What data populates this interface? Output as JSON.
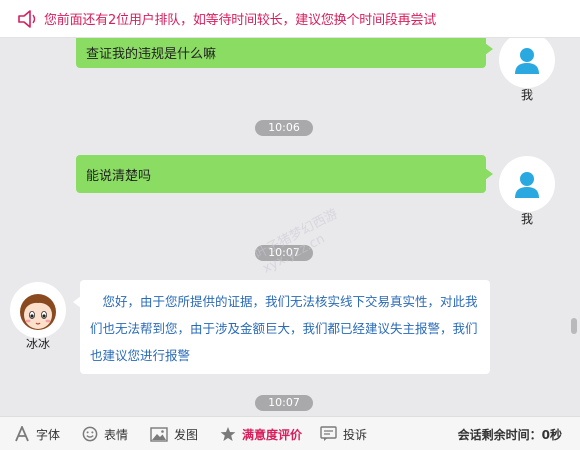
{
  "notice": {
    "text": "您前面还有2位用户排队，如等待时间较长，建议您换个时间段再尝试",
    "icon": "speaker-icon",
    "color": "#d81e5b"
  },
  "messages": [
    {
      "sender": "me",
      "name": "我",
      "text": "查证我的违规是什么嘛"
    },
    {
      "type": "time",
      "text": "10:06"
    },
    {
      "sender": "me",
      "name": "我",
      "text": "能说清楚吗"
    },
    {
      "type": "time",
      "text": "10:07"
    },
    {
      "sender": "agent",
      "name": "冰冰",
      "text": "您好，由于您所提供的证据，我们无法核实线下交易真实性，对此我们也无法帮到您，由于涉及金额巨大，我们都已经建议失主报警，我们也建议您进行报警"
    },
    {
      "type": "time",
      "text": "10:07"
    }
  ],
  "watermark": {
    "line1": "叶子猪梦幻西游",
    "line2": "xyx.yzz.cn"
  },
  "toolbar": {
    "font_label": "字体",
    "emoji_label": "表情",
    "image_label": "发图",
    "rating_label": "满意度评价",
    "report_label": "投诉",
    "remaining_label": "会话剩余时间：",
    "remaining_value": "0秒"
  },
  "colors": {
    "bubble_me": "#8bdc63",
    "agent_text": "#2a6bb8",
    "accent": "#d81e5b",
    "background": "#e9e9ec"
  }
}
